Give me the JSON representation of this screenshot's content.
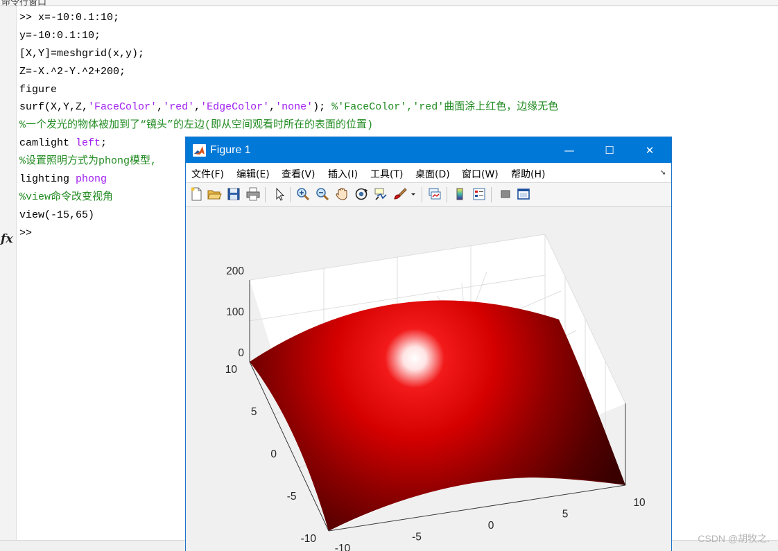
{
  "command_window": {
    "title": "命令行窗口",
    "prompt_icon": "fx",
    "lines": [
      [
        {
          "t": ">> x=-10:0.1:10;"
        }
      ],
      [
        {
          "t": "y=-10:0.1:10;"
        }
      ],
      [
        {
          "t": "[X,Y]=meshgrid(x,y);"
        }
      ],
      [
        {
          "t": "Z=-X.^2-Y.^2+200;"
        }
      ],
      [
        {
          "t": "figure"
        }
      ],
      [
        {
          "t": "surf(X,Y,Z,"
        },
        {
          "t": "'FaceColor'",
          "c": "str"
        },
        {
          "t": ","
        },
        {
          "t": "'red'",
          "c": "str"
        },
        {
          "t": ","
        },
        {
          "t": "'EdgeColor'",
          "c": "str"
        },
        {
          "t": ","
        },
        {
          "t": "'none'",
          "c": "str"
        },
        {
          "t": "); "
        },
        {
          "t": "%'FaceColor','red'曲面涂上红色，边缘无色",
          "c": "cmt"
        }
      ],
      [
        {
          "t": "%一个发光的物体被加到了“镜头”的左边(即从空间观看时所在的表面的位置)",
          "c": "cmt"
        }
      ],
      [
        {
          "t": "camlight "
        },
        {
          "t": "left",
          "c": "str"
        },
        {
          "t": ";"
        }
      ],
      [
        {
          "t": "%设置照明方式为phong模型,",
          "c": "cmt"
        }
      ],
      [
        {
          "t": "lighting "
        },
        {
          "t": "phong",
          "c": "str"
        }
      ],
      [
        {
          "t": "%view命令改变视角",
          "c": "cmt"
        }
      ],
      [
        {
          "t": "view(-15,65)"
        }
      ],
      [
        {
          "t": ">>"
        }
      ]
    ]
  },
  "figure": {
    "title": "Figure 1",
    "window_buttons": {
      "minimize": "—",
      "maximize": "☐",
      "close": "✕"
    },
    "menus": [
      "文件(F)",
      "编辑(E)",
      "查看(V)",
      "插入(I)",
      "工具(T)",
      "桌面(D)",
      "窗口(W)",
      "帮助(H)"
    ],
    "menu_overflow": "➘",
    "toolbar": [
      "new-figure",
      "open-file",
      "save",
      "print",
      "edit-plot",
      "zoom-in",
      "zoom-out",
      "pan",
      "rotate-3d",
      "data-cursor",
      "brush",
      "link-plot",
      "insert-colorbar",
      "insert-legend",
      "hide-plot-tools",
      "show-plot-tools"
    ]
  },
  "chart_data": {
    "type": "surface",
    "equation": "Z=-X.^2-Y.^2+200",
    "x_range": [
      -10,
      10
    ],
    "y_range": [
      -10,
      10
    ],
    "z_range": [
      0,
      200
    ],
    "z_ticks": [
      "200",
      "100",
      "0"
    ],
    "y_ticks": [
      "10",
      "5",
      "0",
      "-5",
      "-10"
    ],
    "x_ticks": [
      "-10",
      "-5",
      "0",
      "5",
      "10"
    ],
    "view": {
      "azimuth": -15,
      "elevation": 65
    },
    "face_color": "#e00000",
    "edge_color": "none",
    "lighting": "phong",
    "camlight": "left",
    "grid": true
  },
  "watermark": "CSDN @胡牧之."
}
